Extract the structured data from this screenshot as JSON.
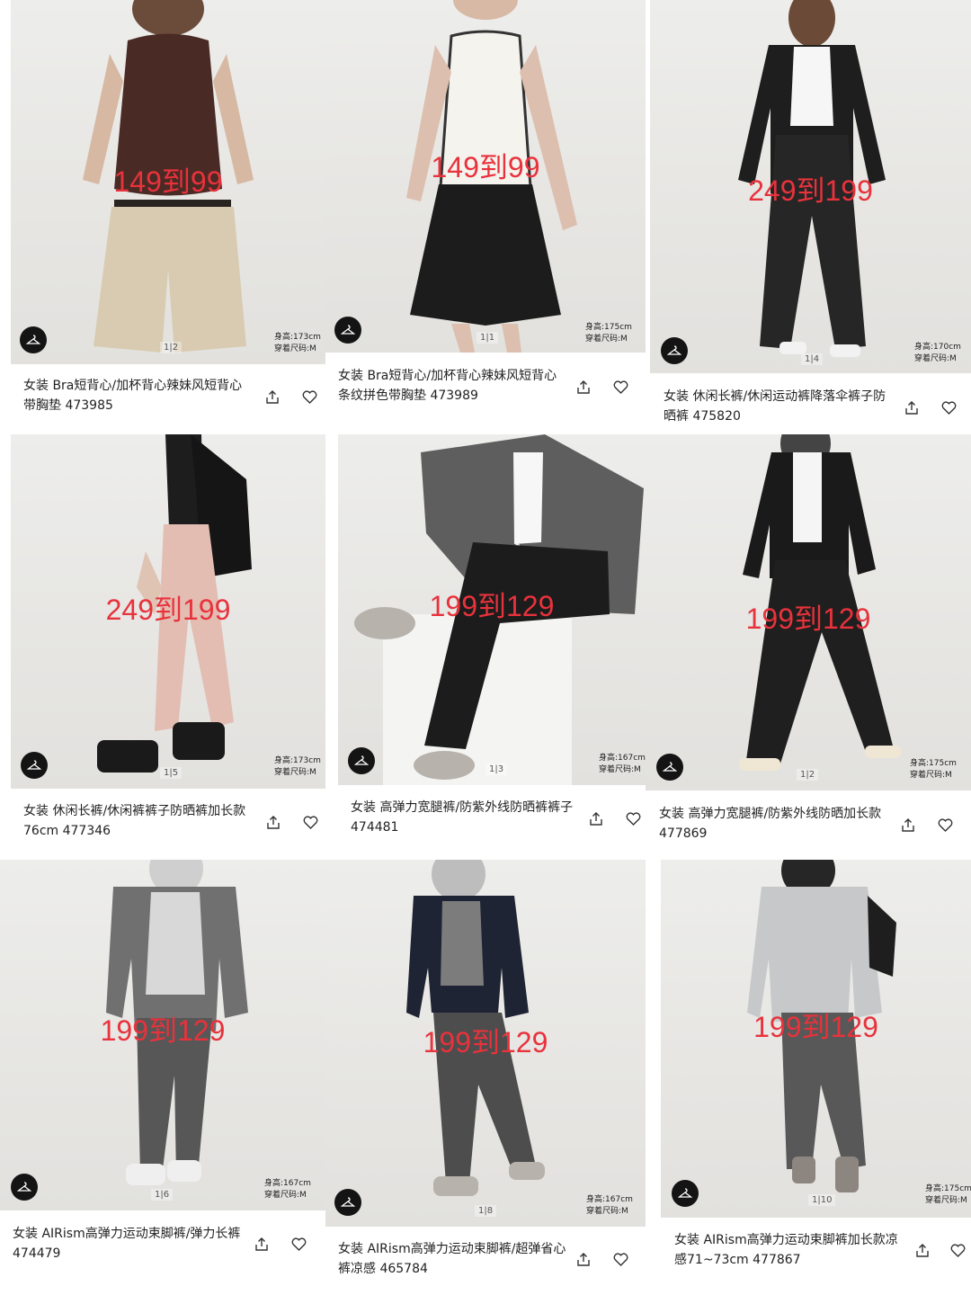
{
  "products": [
    {
      "promo": "149到99",
      "pager": "1|2",
      "height_label": "身高:173cm",
      "size_label": "穿着尺码:M",
      "title": "女装 Bra短背心/加杯背心辣妹风短背心带胸垫 473985"
    },
    {
      "promo": "149到99",
      "pager": "1|1",
      "height_label": "身高:175cm",
      "size_label": "穿着尺码:M",
      "title": "女装 Bra短背心/加杯背心辣妹风短背心条纹拼色带胸垫 473989"
    },
    {
      "promo": "249到199",
      "pager": "1|4",
      "height_label": "身高:170cm",
      "size_label": "穿着尺码:M",
      "title": "女装 休闲长裤/休闲运动裤降落伞裤子防晒裤 475820"
    },
    {
      "promo": "249到199",
      "pager": "1|5",
      "height_label": "身高:173cm",
      "size_label": "穿着尺码:M",
      "title": "女装 休闲长裤/休闲裤裤子防晒裤加长款76cm 477346"
    },
    {
      "promo": "199到129",
      "pager": "1|3",
      "height_label": "身高:167cm",
      "size_label": "穿着尺码:M",
      "title": "女装 高弹力宽腿裤/防紫外线防晒裤裤子 474481"
    },
    {
      "promo": "199到129",
      "pager": "1|2",
      "height_label": "身高:175cm",
      "size_label": "穿着尺码:M",
      "title": "女装 高弹力宽腿裤/防紫外线防晒加长款 477869"
    },
    {
      "promo": "199到129",
      "pager": "1|6",
      "height_label": "身高:167cm",
      "size_label": "穿着尺码:M",
      "title": "女装 AIRism高弹力运动束脚裤/弹力长裤 474479"
    },
    {
      "promo": "199到129",
      "pager": "1|8",
      "height_label": "身高:167cm",
      "size_label": "穿着尺码:M",
      "title": "女装 AIRism高弹力运动束脚裤/超弹省心裤凉感 465784"
    },
    {
      "promo": "199到129",
      "pager": "1|10",
      "height_label": "身高:175cm",
      "size_label": "穿着尺码:M",
      "title": "女装 AIRism高弹力运动束脚裤加长款凉感71~73cm 477867"
    }
  ],
  "icons": {
    "fitting": "hanger-icon",
    "share": "share-icon",
    "favorite": "heart-icon"
  },
  "colors": {
    "promo": "#e8323c",
    "badge": "#141414"
  }
}
